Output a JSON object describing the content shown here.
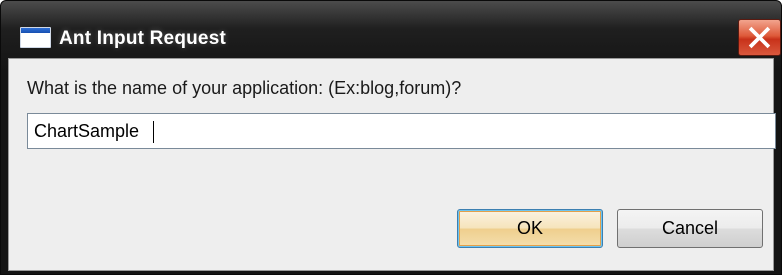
{
  "window": {
    "title": "Ant Input Request",
    "icon": "window-icon"
  },
  "dialog": {
    "prompt": "What is the name of your application: (Ex:blog,forum)?",
    "input_value": "ChartSample",
    "ok_label": "OK",
    "cancel_label": "Cancel"
  },
  "colors": {
    "titlebar": "#1f1f1f",
    "close_button": "#d9472b",
    "content_background": "#eeeeee",
    "default_button_accent": "#efcf8e"
  }
}
